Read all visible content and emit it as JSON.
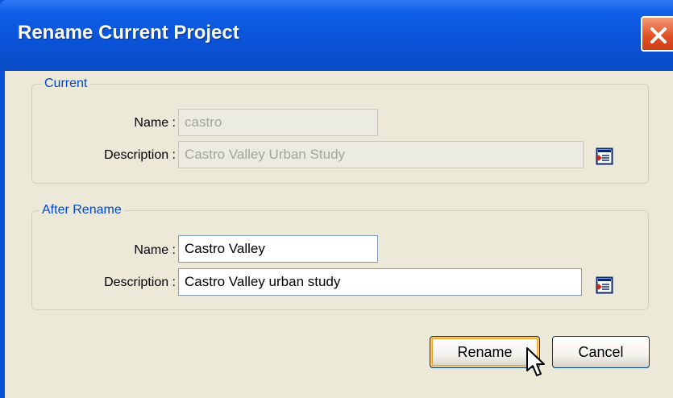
{
  "window": {
    "title": "Rename Current Project"
  },
  "current": {
    "legend": "Current",
    "name_label": "Name :",
    "name_value": "castro",
    "description_label": "Description :",
    "description_value": "Castro Valley Urban Study"
  },
  "after": {
    "legend": "After Rename",
    "name_label": "Name :",
    "name_value": "Castro Valley",
    "description_label": "Description :",
    "description_value": "Castro Valley urban study"
  },
  "buttons": {
    "rename": "Rename",
    "cancel": "Cancel"
  },
  "icons": {
    "close": "close-icon",
    "browse": "edit-description-icon",
    "cursor": "mouse-pointer-icon"
  },
  "colors": {
    "title_bar": "#0a52d6",
    "dialog_bg": "#ece9d8",
    "legend_text": "#0046d5",
    "close_button": "#e2532a"
  }
}
